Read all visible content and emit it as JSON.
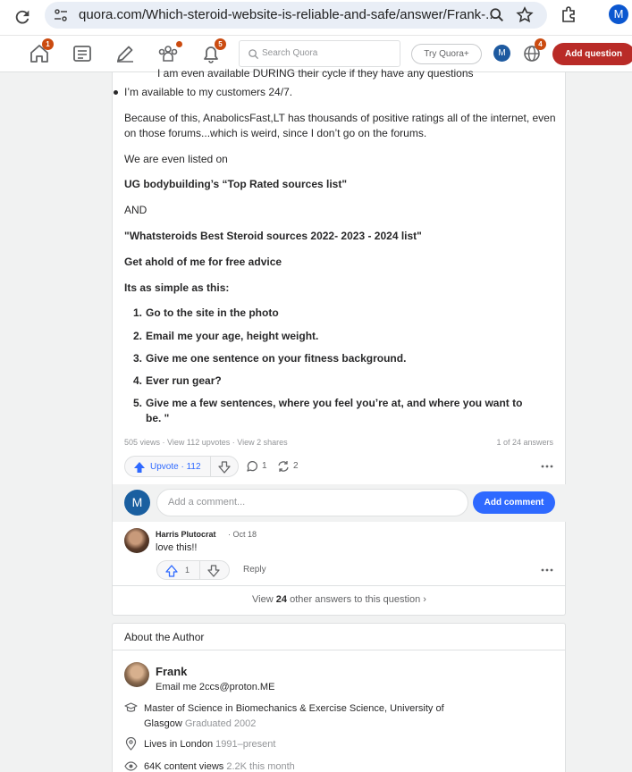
{
  "browser": {
    "url": "quora.com/Which-steroid-website-is-reliable-and-safe/answer/Frank-...",
    "profile_initial": "M"
  },
  "header": {
    "home_badge": "1",
    "notifications_badge": "5",
    "languages_badge": "4",
    "search_placeholder": "Search Quora",
    "try_label": "Try Quora+",
    "avatar_initial": "M",
    "add_question_label": "Add question"
  },
  "answer": {
    "cutoff_line": "I am even available DURING their cycle if they have any questions",
    "bullet": "I’m available to my customers 24/7.",
    "para1": "Because of this, AnabolicsFast,LT has thousands of positive ratings all of the internet, even on those forums...which is weird, since I don’t go on the forums.",
    "para2": "We are even listed on",
    "ug": "UG bodybuilding’s “Top Rated sources list\"",
    "and": "AND",
    "whatsteroids": "\"Whatsteroids Best Steroid sources 2022- 2023 - 2024 list\"",
    "advice": "Get ahold of me for free advice",
    "simple": "Its as simple as this:",
    "steps": [
      {
        "n": "1.",
        "t": "Go to the site in the photo"
      },
      {
        "n": "2.",
        "t": "Email me your age, height weight."
      },
      {
        "n": "3.",
        "t": "Give me one sentence on your fitness background."
      },
      {
        "n": "4.",
        "t": "Ever run gear?"
      },
      {
        "n": "5.",
        "t": "Give me a few sentences, where you feel you’re at, and where you want to be. \""
      }
    ]
  },
  "stats": {
    "left": "505 views · View 112 upvotes · View 2 shares",
    "right": "1 of 24 answers"
  },
  "actions": {
    "upvote_label": "Upvote · 112",
    "comments": "1",
    "shares": "2"
  },
  "comment_box": {
    "avatar_initial": "M",
    "placeholder": "Add a comment...",
    "button": "Add comment"
  },
  "comment": {
    "author": "Harris Plutocrat",
    "date": "· Oct 18",
    "text": "love this!!",
    "upvotes": "1",
    "reply_label": "Reply"
  },
  "view_other": {
    "prefix": "View",
    "count": "24",
    "suffix": "other answers to this question"
  },
  "about": {
    "title": "About the Author",
    "name": "Frank",
    "tagline": "Email me 2ccs@proton.ME",
    "education": "Master of Science in Biomechanics & Exercise Science, University of Glasgow",
    "education_year": "Graduated 2002",
    "location": "Lives in London",
    "location_years": "1991–present",
    "views": "64K content views",
    "views_month": "2.2K this month"
  }
}
